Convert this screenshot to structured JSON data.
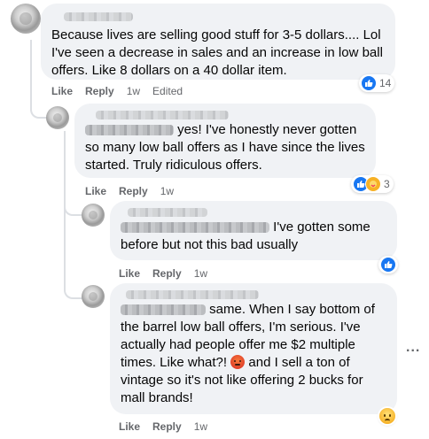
{
  "comments": [
    {
      "text": "Because lives are selling good stuff for 3-5 dollars.... Lol I've seen a decrease in sales and an increase in low ball offers. Like 8 dollars on a 40 dollar item.",
      "like": "Like",
      "reply": "Reply",
      "time": "1w",
      "edited": "Edited",
      "reaction_count": "14"
    },
    {
      "text": "yes! I've honestly never gotten so many low ball offers as I have since the lives started. Truly ridiculous offers.",
      "like": "Like",
      "reply": "Reply",
      "time": "1w",
      "reaction_count": "3"
    },
    {
      "text": "I've gotten some before but not this bad usually",
      "like": "Like",
      "reply": "Reply",
      "time": "1w"
    },
    {
      "text_part1": "same. When I say bottom of the barrel low ball offers, I'm serious. I've actually had people offer me $2 multiple times. Like what?!",
      "text_part2": "and I sell a ton of vintage so it's not like offering 2 bucks for mall brands!",
      "like": "Like",
      "reply": "Reply",
      "time": "1w"
    }
  ],
  "more_menu": "..."
}
